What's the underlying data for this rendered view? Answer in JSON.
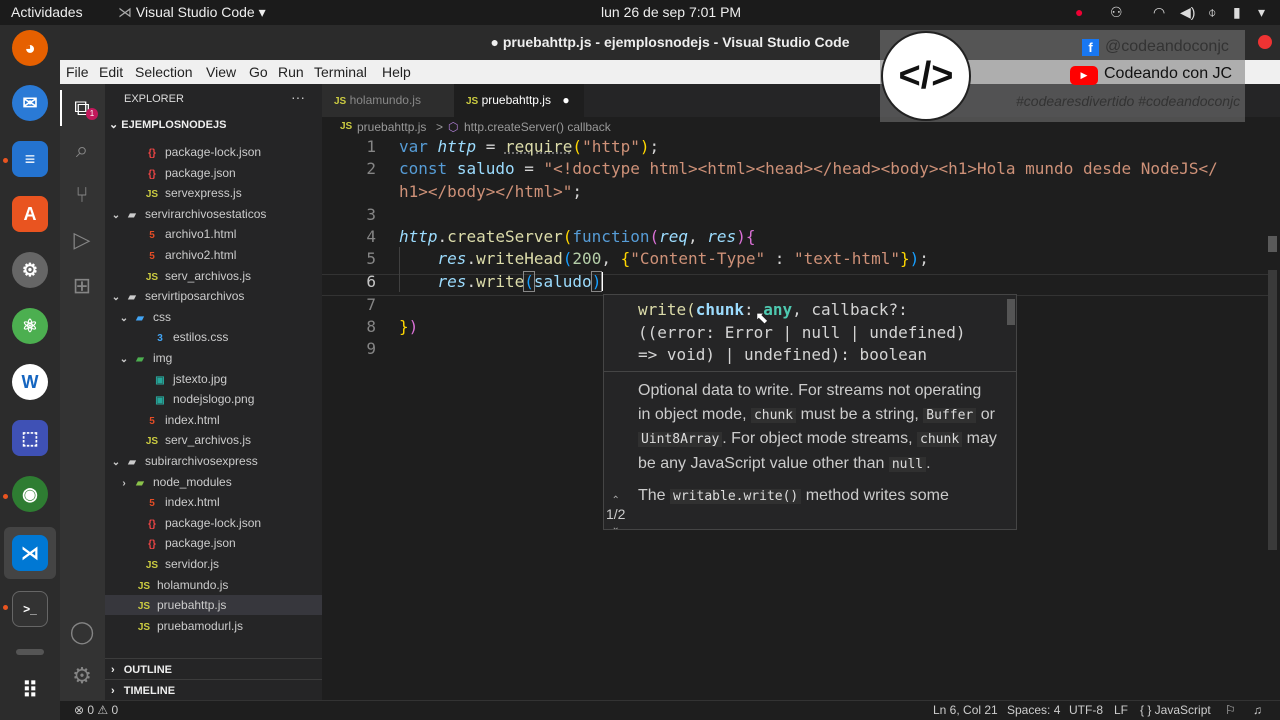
{
  "topbar": {
    "activities": "Actividades",
    "app": "Visual Studio Code",
    "clock": "lun 26 de sep   7:01 PM"
  },
  "window": {
    "title": "● pruebahttp.js - ejemplosnodejs - Visual Studio Code"
  },
  "menu": [
    "File",
    "Edit",
    "Selection",
    "View",
    "Go",
    "Run",
    "Terminal",
    "Help"
  ],
  "sidebar": {
    "title": "EXPLORER",
    "root": "EJEMPLOSNODEJS",
    "items": [
      {
        "label": "package-lock.json",
        "icon": "{}",
        "color": "#e44"
      },
      {
        "label": "package.json",
        "icon": "{}",
        "color": "#e44"
      },
      {
        "label": "servexpress.js",
        "icon": "JS",
        "color": "#cbcb41"
      },
      {
        "label": "servirarchivosestaticos",
        "icon": "▸",
        "color": "#ccc"
      },
      {
        "label": "archivo1.html",
        "icon": "5",
        "color": "#e44d26"
      },
      {
        "label": "archivo2.html",
        "icon": "5",
        "color": "#e44d26"
      },
      {
        "label": "serv_archivos.js",
        "icon": "JS",
        "color": "#cbcb41"
      },
      {
        "label": "servirtiposarchivos",
        "icon": "▸",
        "color": "#ccc"
      },
      {
        "label": "css",
        "icon": "▸",
        "color": "#42a5f5"
      },
      {
        "label": "estilos.css",
        "icon": "3",
        "color": "#42a5f5"
      },
      {
        "label": "img",
        "icon": "▸",
        "color": "#4caf50"
      },
      {
        "label": "jstexto.jpg",
        "icon": "▣",
        "color": "#26a69a"
      },
      {
        "label": "nodejslogo.png",
        "icon": "▣",
        "color": "#26a69a"
      },
      {
        "label": "index.html",
        "icon": "5",
        "color": "#e44d26"
      },
      {
        "label": "serv_archivos.js",
        "icon": "JS",
        "color": "#cbcb41"
      },
      {
        "label": "subirarchivosexpress",
        "icon": "▸",
        "color": "#ccc"
      },
      {
        "label": "node_modules",
        "icon": "▸",
        "color": "#8bc34a"
      },
      {
        "label": "index.html",
        "icon": "5",
        "color": "#e44d26"
      },
      {
        "label": "package-lock.json",
        "icon": "{}",
        "color": "#e44"
      },
      {
        "label": "package.json",
        "icon": "{}",
        "color": "#e44"
      },
      {
        "label": "servidor.js",
        "icon": "JS",
        "color": "#cbcb41"
      },
      {
        "label": "holamundo.js",
        "icon": "JS",
        "color": "#cbcb41"
      },
      {
        "label": "pruebahttp.js",
        "icon": "JS",
        "color": "#cbcb41"
      },
      {
        "label": "pruebamodurl.js",
        "icon": "JS",
        "color": "#cbcb41"
      }
    ],
    "outline": "OUTLINE",
    "timeline": "TIMELINE"
  },
  "tabs": [
    {
      "label": "holamundo.js",
      "icon": "JS"
    },
    {
      "label": "pruebahttp.js",
      "icon": "JS",
      "dirty": "●"
    }
  ],
  "breadcrumb": {
    "file": "pruebahttp.js",
    "sep": ">",
    "symbol": "http.createServer() callback"
  },
  "code": {
    "line_numbers": [
      "1",
      "2",
      "",
      "3",
      "4",
      "5",
      "6",
      "7",
      "8",
      "9"
    ]
  },
  "hover": {
    "sig1a": "write(",
    "sig1b": "chunk",
    "sig1c": ": ",
    "sig1d": "any",
    "sig1e": ", callback?:",
    "sig2": "((error: Error | null | undefined)",
    "sig3": "=> void) | undefined): boolean",
    "d1": "Optional data to write. For streams not operating in object mode,",
    "c1": "chunk",
    "d2": "must be a string,",
    "c2": "Buffer",
    "d3": "or",
    "c3": "Uint8Array",
    "d4": ". For object mode streams,",
    "c4": "chunk",
    "d5": "may be any JavaScript value other than",
    "c5": "null",
    "d6": ".",
    "d7": "The",
    "c6": "writable.write()",
    "d8": "method writes some",
    "pager": "1/2"
  },
  "overlay": {
    "facebook": "@codeandoconjc",
    "youtube": "Codeando con JC",
    "hashtags": "#codearesdivertido #codeandoconjc"
  },
  "status": {
    "errors": "⊗ 0 ⚠ 0",
    "pos": "Ln 6, Col 21",
    "spaces": "Spaces: 4",
    "enc": "UTF-8",
    "eol": "LF",
    "lang": "{ } JavaScript"
  }
}
